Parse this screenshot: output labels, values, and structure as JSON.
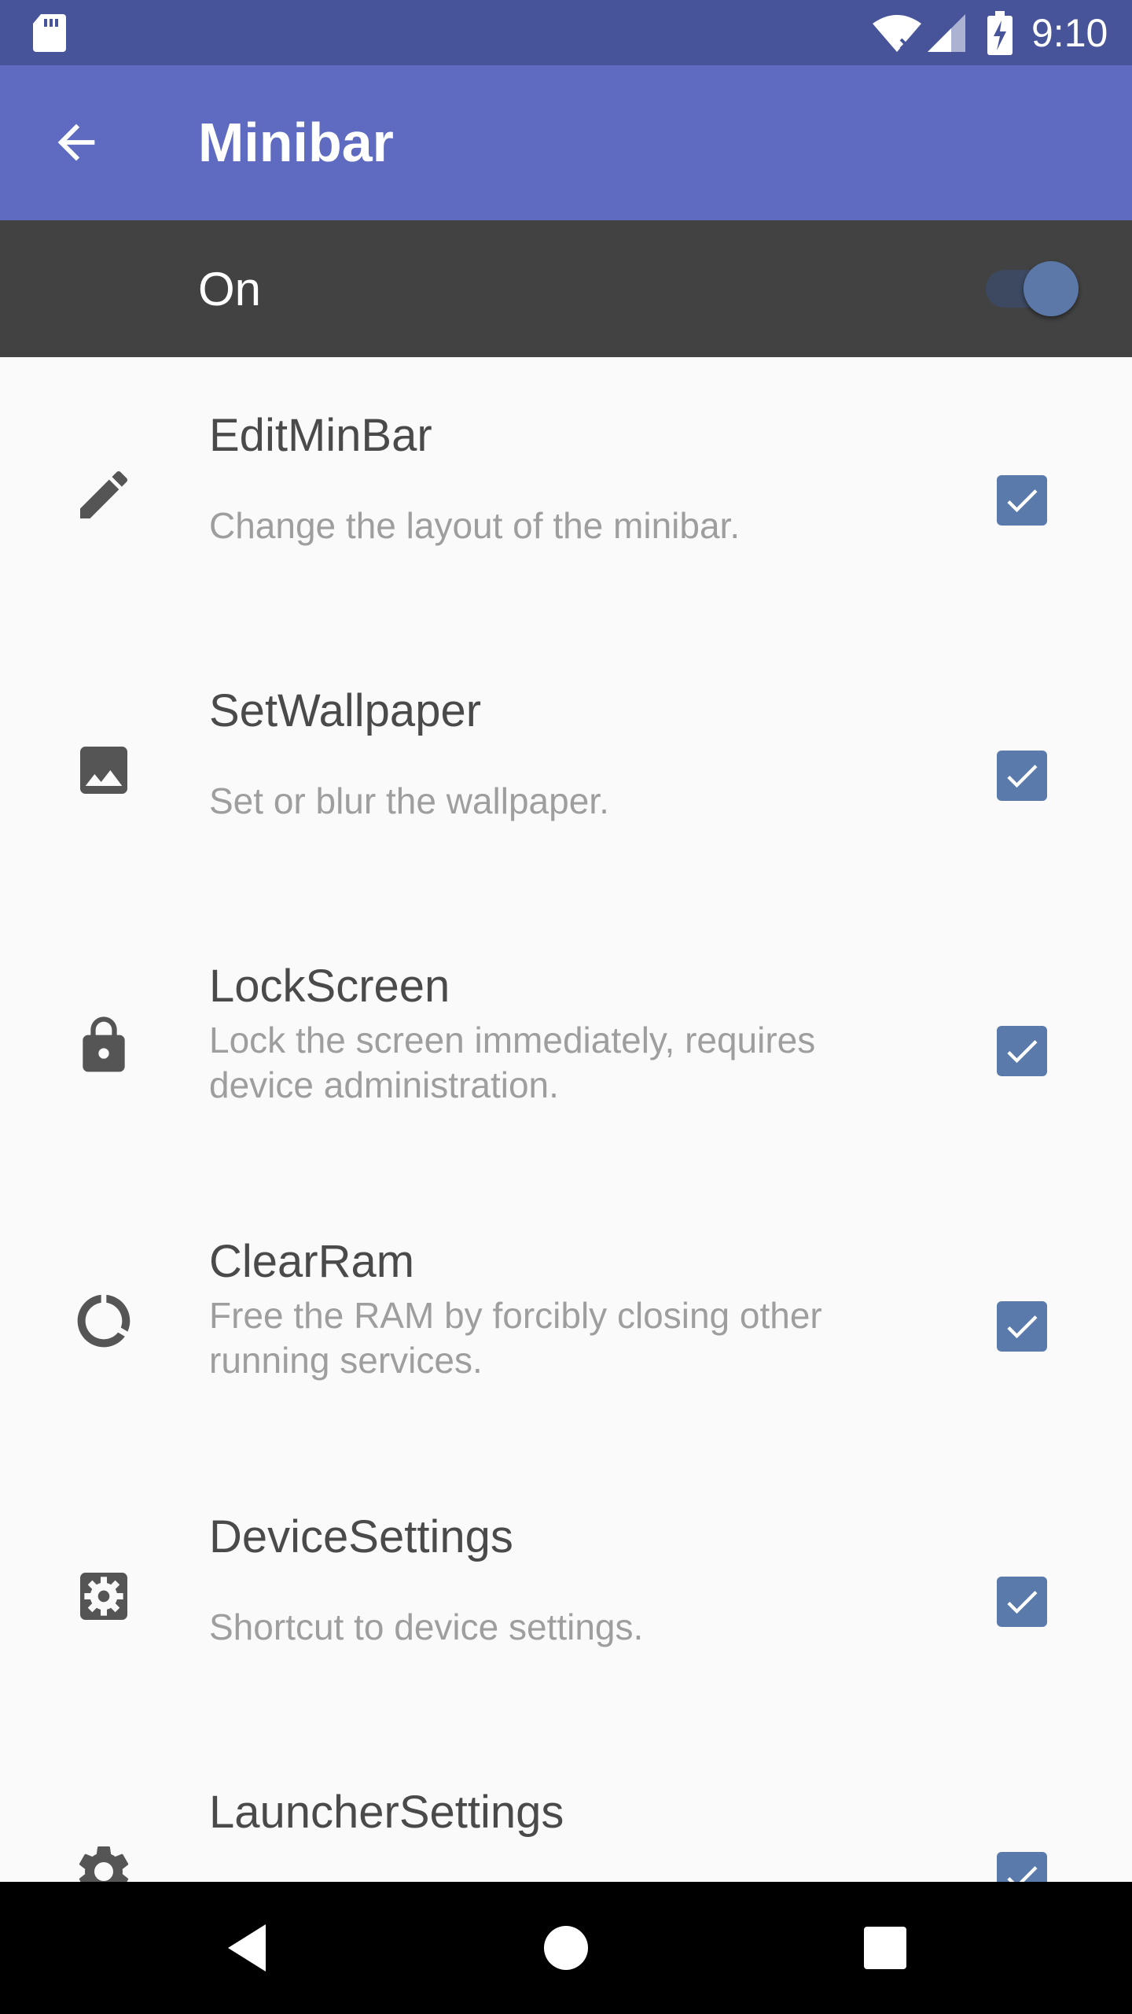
{
  "status_bar": {
    "time": "9:10",
    "icons": [
      "sd-card-icon",
      "wifi-icon",
      "signal-icon",
      "battery-charging-icon"
    ]
  },
  "app_bar": {
    "back_icon": "arrow-back-icon",
    "title": "Minibar"
  },
  "master_switch": {
    "label": "On",
    "checked": true
  },
  "items": [
    {
      "icon": "pencil-icon",
      "title": "EditMinBar",
      "summary": "Change the layout of the minibar.",
      "checked": true
    },
    {
      "icon": "image-icon",
      "title": "SetWallpaper",
      "summary": "Set or blur the wallpaper.",
      "checked": true
    },
    {
      "icon": "lock-icon",
      "title": "LockScreen",
      "summary": "Lock the screen immediately, requires device administration.",
      "checked": true
    },
    {
      "icon": "memory-ring-icon",
      "title": "ClearRam",
      "summary": "Free the RAM by forcibly closing other running services.",
      "checked": true
    },
    {
      "icon": "device-settings-icon",
      "title": "DeviceSettings",
      "summary": "Shortcut to device settings.",
      "checked": true
    },
    {
      "icon": "gear-icon",
      "title": "LauncherSettings",
      "summary": "",
      "checked": true
    }
  ],
  "nav_bar": {
    "icons": [
      "back-triangle-icon",
      "home-circle-icon",
      "recents-square-icon"
    ]
  },
  "colors": {
    "status_bar": "#48549a",
    "app_bar": "#5f6bc0",
    "switch_bar": "#424242",
    "checkbox": "#5a7aab",
    "background": "#fafafa"
  }
}
